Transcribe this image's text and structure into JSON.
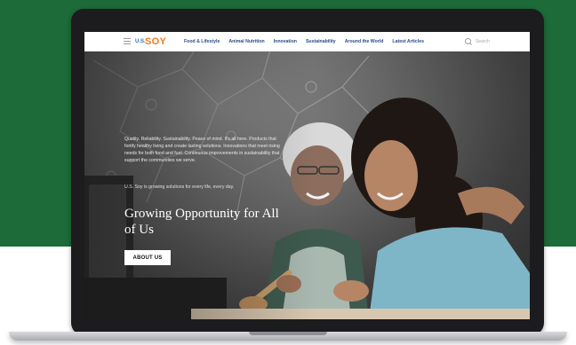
{
  "brand": {
    "logo_mark": "U.S.",
    "logo_text": "SOY",
    "colors": {
      "green": "#1d6b38",
      "orange": "#f07d1e",
      "blue": "#2c6fb7",
      "nav_text": "#2a4a8a"
    }
  },
  "nav": {
    "menu_icon": "hamburger-icon",
    "links": [
      "Food & Lifestyle",
      "Animal Nutrition",
      "Innovation",
      "Sustainability",
      "Around the World",
      "Latest Articles"
    ],
    "search_icon": "search-icon",
    "search_label": "Search"
  },
  "hero": {
    "paragraph": "Quality. Reliability. Sustainability. Peace of mind. It's all here. Products that fortify healthy living and create lasting solutions. Innovations that meet rising needs for both food and fuel. Continuous improvements in sustainability that support the communities we serve.",
    "subline": "U.S. Soy is growing solutions for every life, every day.",
    "title": "Growing Opportunity for All of Us",
    "button_label": "ABOUT US"
  }
}
